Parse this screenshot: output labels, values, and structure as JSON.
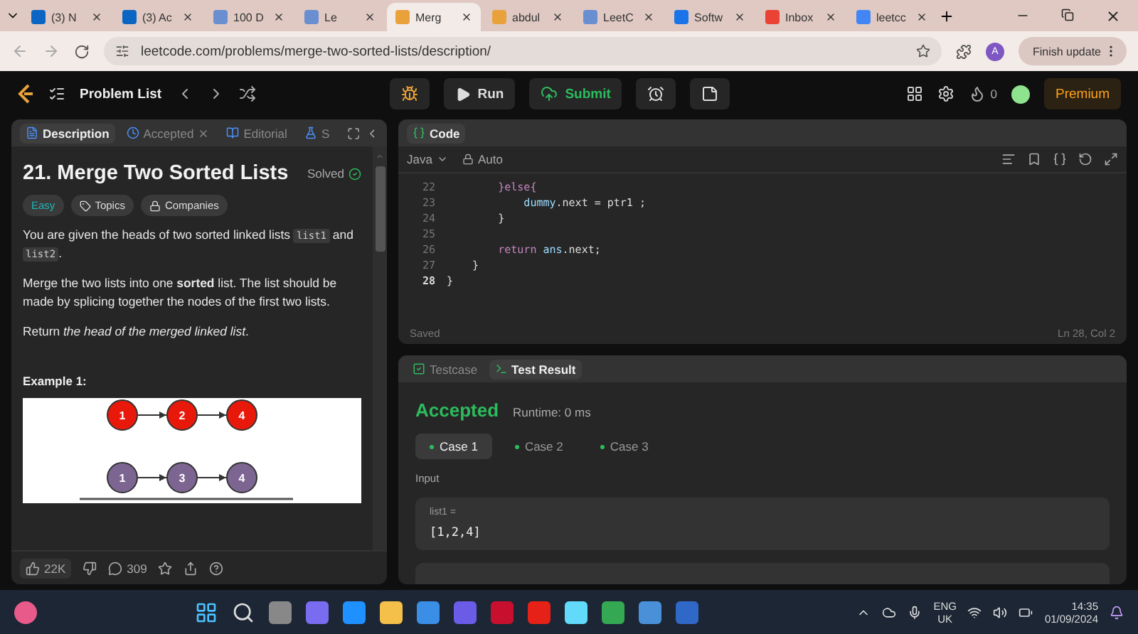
{
  "browser_tabs": [
    {
      "title": "(3) N",
      "selected": false
    },
    {
      "title": "(3) Ac",
      "selected": false
    },
    {
      "title": "100 D",
      "selected": false
    },
    {
      "title": "Le",
      "selected": false
    },
    {
      "title": "Merg",
      "selected": true
    },
    {
      "title": "abdul",
      "selected": false
    },
    {
      "title": "LeetC",
      "selected": false
    },
    {
      "title": "Softw",
      "selected": false
    },
    {
      "title": "Inbox",
      "selected": false
    },
    {
      "title": "leetcc",
      "selected": false
    }
  ],
  "address_bar": {
    "url": "leetcode.com/problems/merge-two-sorted-lists/description/",
    "profile_initial": "A",
    "update_button": "Finish update"
  },
  "nav": {
    "problem_list": "Problem List",
    "run": "Run",
    "submit": "Submit",
    "streak": "0",
    "premium": "Premium"
  },
  "left_panel": {
    "tabs": [
      {
        "label": "Description",
        "selected": true
      },
      {
        "label": "Accepted",
        "selected": false
      },
      {
        "label": "Editorial",
        "selected": false
      },
      {
        "label": "S",
        "selected": false
      }
    ],
    "title": "21. Merge Two Sorted Lists",
    "status": "Solved",
    "difficulty": "Easy",
    "chips": [
      "Topics",
      "Companies"
    ],
    "intro": [
      {
        "kind": "text",
        "text": "You are given the heads of two sorted linked lists "
      },
      {
        "kind": "code",
        "text": "list1"
      },
      {
        "kind": "text",
        "text": " and "
      },
      {
        "kind": "code",
        "text": "list2"
      },
      {
        "kind": "text",
        "text": "."
      }
    ],
    "paragraphs": [
      "Merge the two lists into one **sorted** list. The list should be made by splicing together the nodes of the first two lists.",
      "Return *the head of the merged linked list*."
    ],
    "example_title": "Example 1:",
    "example_lists": [
      {
        "color": "#e8190b",
        "nodes": [
          "1",
          "2",
          "4"
        ]
      },
      {
        "color": "#7d6591",
        "nodes": [
          "1",
          "3",
          "4"
        ]
      }
    ],
    "likes": "22K",
    "comments": "309"
  },
  "code_panel": {
    "title": "Code",
    "language": "Java",
    "mode": "Auto",
    "lines": [
      {
        "number": "22",
        "current": false,
        "tokens": [
          {
            "kind": "keyword",
            "text": "        }else{"
          }
        ]
      },
      {
        "number": "23",
        "current": false,
        "tokens": [
          {
            "kind": "ident",
            "text": "            dummy"
          },
          {
            "kind": "plain",
            "text": ".next = ptr1 ;"
          }
        ]
      },
      {
        "number": "24",
        "current": false,
        "tokens": [
          {
            "kind": "plain",
            "text": "        }"
          }
        ]
      },
      {
        "number": "25",
        "current": false
      },
      {
        "number": "26",
        "current": false,
        "tokens": [
          {
            "kind": "keyword",
            "text": "        return"
          },
          {
            "kind": "ident",
            "text": " ans"
          },
          {
            "kind": "plain",
            "text": ".next;"
          }
        ]
      },
      {
        "number": "27",
        "current": false,
        "tokens": [
          {
            "kind": "plain",
            "text": "    }"
          }
        ]
      },
      {
        "number": "28",
        "current": true,
        "tokens": [
          {
            "kind": "plain",
            "text": "}"
          }
        ]
      }
    ],
    "saved": "Saved",
    "cursor": "Ln 28, Col 2"
  },
  "result_panel": {
    "tabs": [
      {
        "label": "Testcase",
        "selected": false
      },
      {
        "label": "Test Result",
        "selected": true
      }
    ],
    "verdict": "Accepted",
    "runtime": "Runtime: 0 ms",
    "cases": [
      {
        "label": "Case 1",
        "selected": true
      },
      {
        "label": "Case 2",
        "selected": false
      },
      {
        "label": "Case 3",
        "selected": false
      }
    ],
    "input_label": "Input",
    "inputs": [
      {
        "name": "list1 =",
        "value": "[1,2,4]"
      }
    ]
  },
  "taskbar": {
    "language": "ENG",
    "region": "UK",
    "time": "14:35",
    "date": "01/09/2024"
  }
}
